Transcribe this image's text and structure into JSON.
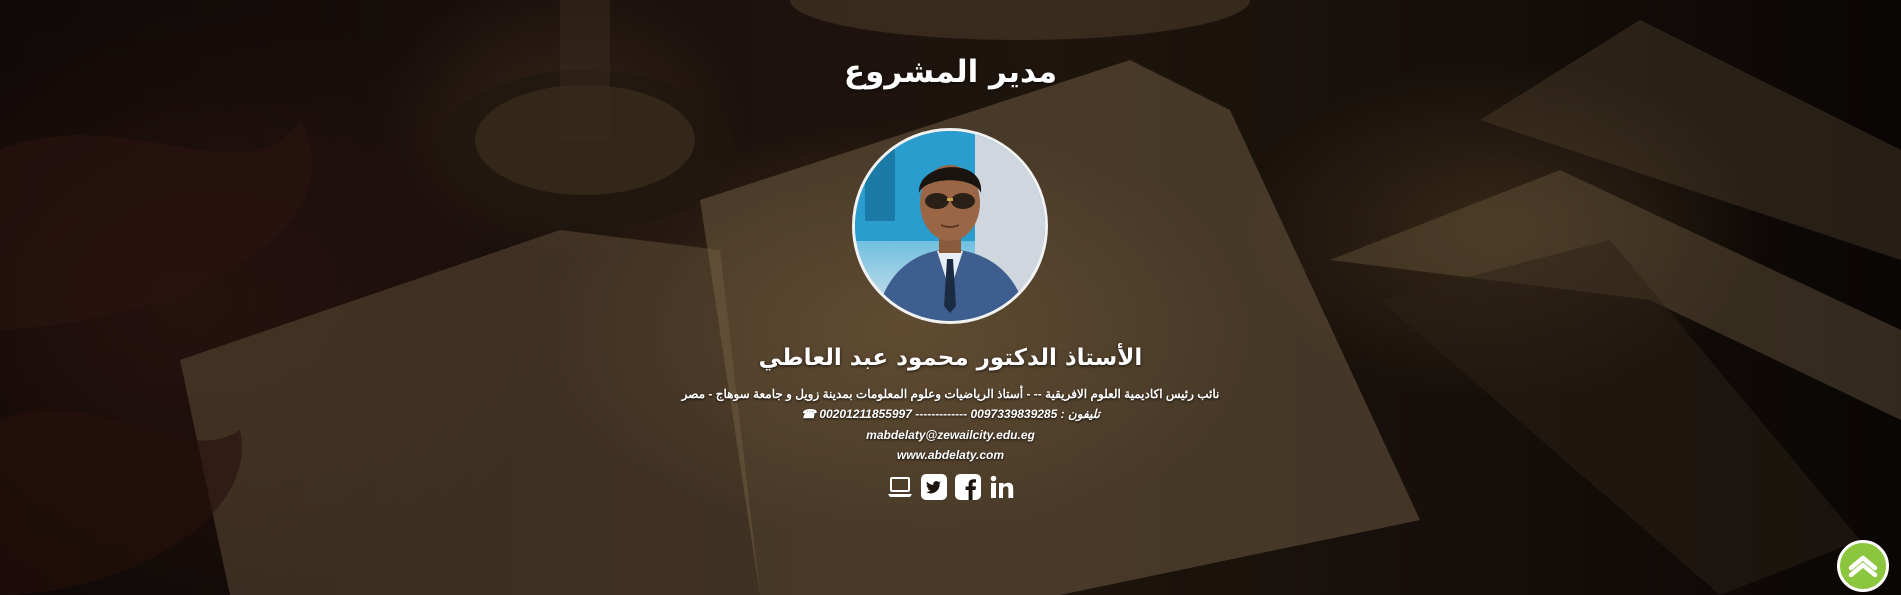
{
  "section": {
    "title": "مدير المشروع"
  },
  "person": {
    "name": "الأستاذ الدكتور محمود عبد العاطي",
    "position": "نائب رئيس اكاديمية العلوم الافريقية -- - أستاذ الرياضيات وعلوم المعلومات بمدينة زويل و جامعة سوهاج - مصر",
    "phone_icon": "☎",
    "phone": "تليفون : 0097339839285 ------------- 00201211855997",
    "email": "mabdelaty@zewailcity.edu.eg",
    "website": "www.abdelaty.com"
  },
  "social_icons": [
    "laptop-icon",
    "twitter-icon",
    "facebook-icon",
    "linkedin-icon"
  ],
  "colors": {
    "scroll_top_bg": "#8cc63f",
    "text": "#ffffff"
  }
}
